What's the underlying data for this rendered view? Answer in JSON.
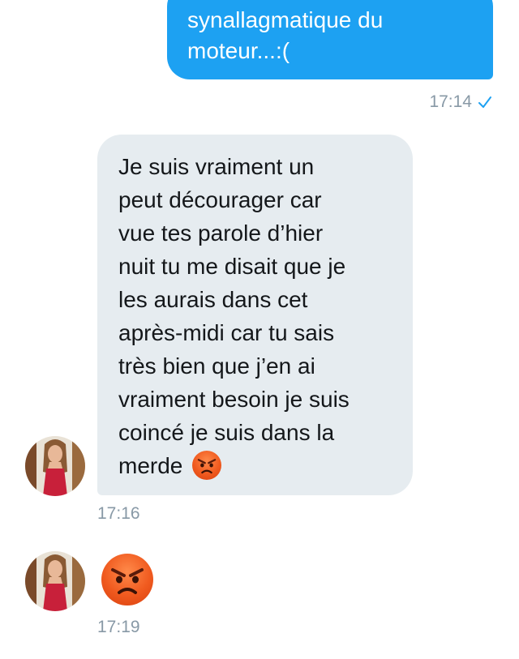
{
  "conversation": {
    "outgoing": {
      "lines": [
        "synallagmatique du",
        "moteur...:("
      ],
      "time": "17:14",
      "status_icon": "read-check-icon"
    },
    "incoming": [
      {
        "lines": [
          "Je suis vraiment un",
          "peut décourager car",
          "vue tes parole d’hier",
          "nuit tu me disait que je",
          "les aurais dans cet",
          "après-midi car tu sais",
          "très bien que j’en ai",
          "vraiment besoin je suis",
          "coincé je suis dans la",
          "merde"
        ],
        "emoji": "angry-face-icon",
        "time": "17:16"
      },
      {
        "emoji": "angry-face-icon",
        "time": "17:19"
      }
    ]
  },
  "colors": {
    "outgoing_bubble": "#1DA1F2",
    "incoming_bubble": "#E6ECF0",
    "timestamp": "#8899A6",
    "text": "#14171A"
  }
}
